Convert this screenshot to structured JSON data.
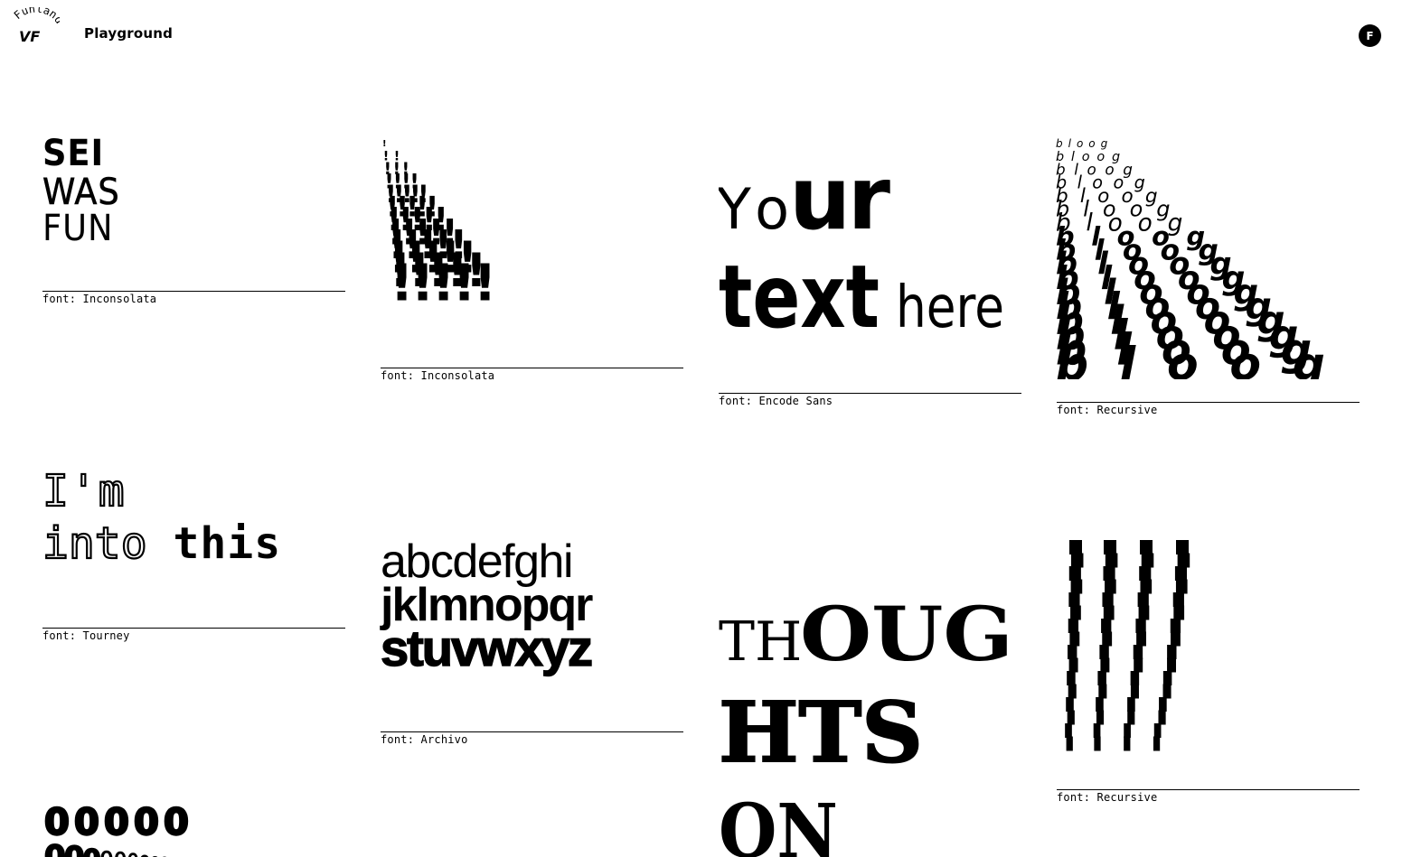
{
  "header": {
    "logo_arc_text": "Funland",
    "logo_mark": "VF",
    "title": "Playground",
    "avatar_initial": "F"
  },
  "cards": [
    {
      "lines": [
        "SEI",
        "WAS",
        "FUN"
      ],
      "caption": "font: Inconsolata"
    },
    {
      "glyph": "!",
      "caption": "font: Inconsolata"
    },
    {
      "lines": [
        "Your",
        "text here"
      ],
      "caption": "font: Encode Sans"
    },
    {
      "word": "bloog",
      "caption": "font: Recursive"
    },
    {
      "lines": [
        "I'm",
        "into this"
      ],
      "caption": "font: Tourney"
    },
    {
      "lines": [
        "abcdefghi",
        "jklmnopqr",
        "stuvwxyz"
      ],
      "caption": "font: Archivo"
    },
    {
      "lines": [
        "THOUG",
        "HTS",
        "ON"
      ]
    },
    {
      "caption": "font: Recursive"
    },
    {
      "glyphs": "00000"
    }
  ]
}
